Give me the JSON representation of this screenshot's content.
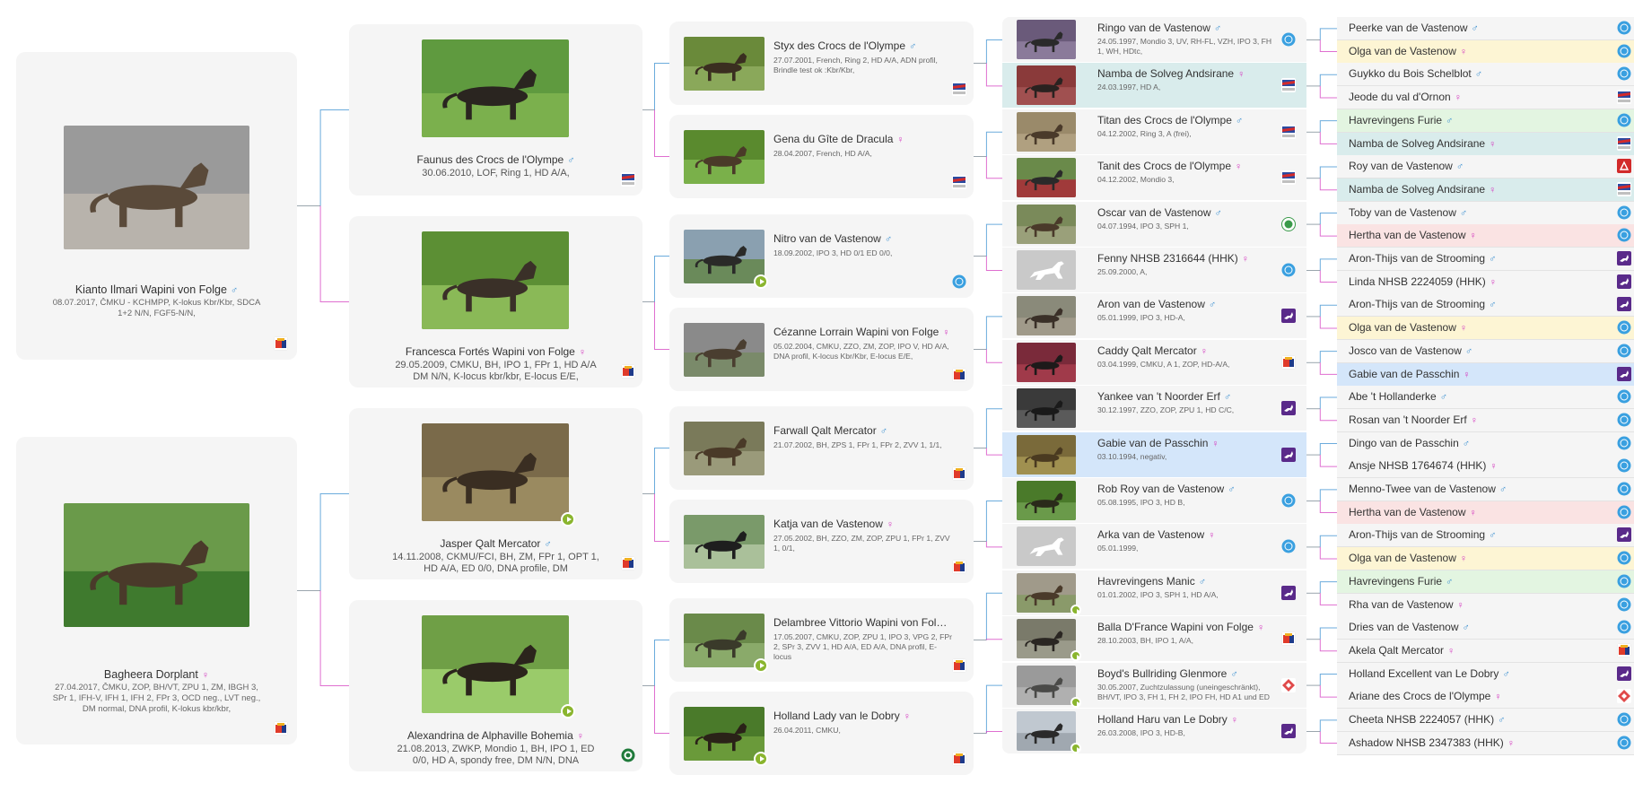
{
  "colors": {
    "male": "#3a8fd0",
    "female": "#d43fc0",
    "card_bg": "#f5f5f5",
    "line": "#9aa5ad",
    "highlight_teal": "#d9ecec",
    "highlight_blue": "#d4e6fa",
    "highlight_yellow": "#fdf5d4",
    "highlight_green": "#e3f5e1",
    "highlight_red": "#fae3e3"
  },
  "symbols": {
    "male": "♂",
    "female": "♀"
  },
  "gen1": [
    {
      "name": "Kianto Ilmari Wapini von Folge",
      "sex": "male",
      "info": "08.07.2017, ČMKU - KCHMPP, K-lokus Kbr/Kbr, SDCA 1+2 N/N, FGF5-N/N,",
      "flag": "cz-cmku",
      "photo": "dog-red-handler",
      "video": false
    },
    {
      "name": "Bagheera Dorplant",
      "sex": "female",
      "info": "27.04.2017, ČMKU, ZOP, BH/VT, ZPU 1, ZM, IBGH 3, SPr 1, IFH-V, IFH 1, IFH 2, FPr 3, OCD neg., LVT neg., DM normal, DNA profil, K-lokus kbr/kbr,",
      "flag": "cz-cmku",
      "photo": "dog-bite-training",
      "video": false
    }
  ],
  "gen2": [
    {
      "name": "Faunus des Crocs de l'Olympe",
      "sex": "male",
      "info": "30.06.2010, LOF, Ring 1, HD A/A,",
      "flag": "fr-lof",
      "photo": "dog-standing-grass",
      "video": false
    },
    {
      "name": "Francesca Fortés Wapini von Folge",
      "sex": "female",
      "info": "29.05.2009, CMKU, BH, IPO 1, FPr 1, HD A/A DM N/N, K-locus kbr/kbr, E-locus E/E,",
      "flag": "cz-cmku",
      "photo": "dog-stack-grass",
      "video": false
    },
    {
      "name": "Jasper Qalt Mercator",
      "sex": "male",
      "info": "14.11.2008, CKMU/FCI, BH, ZM, FPr 1, OPT 1, HD A/A, ED 0/0, DNA profile, DM",
      "flag": "cz-cmku",
      "photo": "dog-helper-dirt",
      "video": true
    },
    {
      "name": "Alexandrina de Alphaville Bohemia",
      "sex": "female",
      "info": "21.08.2013, ZWKP, Mondio 1, BH, IPO 1, ED 0/0, HD A, spondy free, DM N/N, DNA",
      "flag": "zwkp",
      "photo": "dog-head-portrait",
      "video": true
    }
  ],
  "gen3": [
    {
      "name": "Styx des Crocs de l'Olympe",
      "sex": "male",
      "info": "27.07.2001, French, Ring 2, HD A/A, ADN profil, Brindle test ok :Kbr/Kbr,",
      "flag": "fr-lof",
      "photo": "dog-sit-grass",
      "video": false
    },
    {
      "name": "Gena du Gîte de Dracula",
      "sex": "female",
      "info": "28.04.2007, French, HD A/A,",
      "flag": "fr-lof",
      "photo": "dog-grass-side",
      "video": false
    },
    {
      "name": "Nitro van de Vastenow",
      "sex": "male",
      "info": "18.09.2002, IPO 3, HD 0/1 ED 0/0,",
      "flag": "nl-ring",
      "photo": "dog-lake",
      "video": true
    },
    {
      "name": "Cézanne Lorrain Wapini von Folge",
      "sex": "female",
      "info": "05.02.2004, CMKU, ZZO, ZM, ZOP, IPO V, HD A/A, DNA profil, K-locus Kbr/Kbr, E-locus E/E,",
      "flag": "cz-cmku",
      "photo": "dog-pavement",
      "video": false
    },
    {
      "name": "Farwall Qalt Mercator",
      "sex": "male",
      "info": "21.07.2002, BH, ZPS 1, FPr 1, FPr 2, ZVV 1, 1/1,",
      "flag": "cz-cmku",
      "photo": "dog-head-brown",
      "video": false
    },
    {
      "name": "Katja van de Vastenow",
      "sex": "female",
      "info": "27.05.2002, BH, ZZO, ZM, ZOP, ZPU 1, FPr 1, ZVV 1, 0/1,",
      "flag": "cz-cmku",
      "photo": "dog-black-portrait",
      "video": false
    },
    {
      "name": "Delambree Vittorio Wapini von Folge ...",
      "sex": "male",
      "info": "17.05.2007, CMKU, ZOP, ZPU 1, IPO 3, VPG 2, FPr 2, SPr 3, ZVV 1, HD A/A, ED A/A, DNA profil, E-locus",
      "flag": "cz-cmku",
      "photo": "dog-grass-stand2",
      "video": true
    },
    {
      "name": "Holland Lady van le Dobry",
      "sex": "female",
      "info": "26.04.2011, CMKU,",
      "flag": "cz-cmku",
      "photo": "dog-grass-dark",
      "video": true
    }
  ],
  "gen4": [
    {
      "name": "Ringo van de Vastenow",
      "sex": "male",
      "info": "24.05.1997, Mondio 3, UV, RH-FL, VZH, IPO 3, FH 1, WH, HDtc,",
      "flag": "nl-ring",
      "photo": "dog-purple-bg",
      "video": false,
      "highlight": ""
    },
    {
      "name": "Namba de Solveg Andsirane",
      "sex": "female",
      "info": "24.03.1997, HD A,",
      "flag": "fr-lof",
      "photo": "dog-red-bg",
      "video": false,
      "highlight": "highlight_teal"
    },
    {
      "name": "Titan des Crocs de l'Olympe",
      "sex": "male",
      "info": "04.12.2002, Ring 3, A (frei),",
      "flag": "fr-lof",
      "photo": "dog-field",
      "video": false,
      "highlight": ""
    },
    {
      "name": "Tanit des Crocs de l'Olympe",
      "sex": "female",
      "info": "04.12.2002, Mondio 3,",
      "flag": "fr-lof",
      "photo": "dog-people-red",
      "video": false,
      "highlight": ""
    },
    {
      "name": "Oscar van de Vastenow",
      "sex": "male",
      "info": "04.07.1994, IPO 3, SPH 1,",
      "flag": "green-seal",
      "photo": "dog-trophy",
      "video": false,
      "highlight": ""
    },
    {
      "name": "Fenny NHSB 2316644 (HHK)",
      "sex": "female",
      "info": "25.09.2000, A,",
      "flag": "nl-ring",
      "photo": "placeholder",
      "video": false,
      "highlight": ""
    },
    {
      "name": "Aron van de Vastenow",
      "sex": "male",
      "info": "05.01.1999, IPO 3, HD-A,",
      "flag": "purple-dog",
      "photo": "dog-sit-dark",
      "video": false,
      "highlight": ""
    },
    {
      "name": "Caddy Qalt Mercator",
      "sex": "female",
      "info": "03.04.1999, CMKU, A 1, ZOP, HD-A/A,",
      "flag": "cz-cmku",
      "photo": "dog-red-banner",
      "video": false,
      "highlight": ""
    },
    {
      "name": "Yankee van 't Noorder Erf",
      "sex": "male",
      "info": "30.12.1997, ZZO, ZOP, ZPU 1, HD C/C,",
      "flag": "purple-dog",
      "photo": "dog-black-bg",
      "video": false,
      "highlight": ""
    },
    {
      "name": "Gabie van de Passchin",
      "sex": "female",
      "info": "03.10.1994, negativ,",
      "flag": "purple-dog",
      "photo": "dog-lying-brown",
      "video": false,
      "highlight": "highlight_blue"
    },
    {
      "name": "Rob Roy van de Vastenow",
      "sex": "male",
      "info": "05.08.1995, IPO 3, HD B,",
      "flag": "nl-ring",
      "photo": "dog-grass-green",
      "video": false,
      "highlight": ""
    },
    {
      "name": "Arka van de Vastenow",
      "sex": "female",
      "info": "05.01.1999,",
      "flag": "nl-ring",
      "photo": "placeholder",
      "video": false,
      "highlight": ""
    },
    {
      "name": "Havrevingens Manic",
      "sex": "male",
      "info": "01.01.2002, IPO 3, SPH 1, HD A/A,",
      "flag": "purple-dog",
      "photo": "dog-walk-field",
      "video": true,
      "highlight": ""
    },
    {
      "name": "Balla D'France Wapini von Folge",
      "sex": "female",
      "info": "28.10.2003, BH, IPO 1, A/A,",
      "flag": "cz-cmku",
      "photo": "dog-stand-dark",
      "video": true,
      "highlight": ""
    },
    {
      "name": "Boyd's Bullriding Glenmore",
      "sex": "male",
      "info": "30.05.2007, Zuchtzulassung (uneingeschränkt), BH/VT, IPO 3, FH 1, FH 2, IPO FH, HD A1 und ED 0, Schaltwirbel,",
      "flag": "red-diamond",
      "photo": "dog-grey",
      "video": true,
      "highlight": ""
    },
    {
      "name": "Holland Haru van Le Dobry",
      "sex": "female",
      "info": "26.03.2008, IPO 3, HD-B,",
      "flag": "purple-dog",
      "photo": "dog-snow",
      "video": true,
      "highlight": ""
    }
  ],
  "gen5": [
    {
      "name": "Peerke van de Vastenow",
      "sex": "male",
      "flag": "nl-ring",
      "highlight": ""
    },
    {
      "name": "Olga van de Vastenow",
      "sex": "female",
      "flag": "nl-ring",
      "highlight": "highlight_yellow"
    },
    {
      "name": "Guykko du Bois Schelblot",
      "sex": "male",
      "flag": "nl-ring",
      "highlight": ""
    },
    {
      "name": "Jeode du val d'Ornon",
      "sex": "female",
      "flag": "fr-lof",
      "highlight": ""
    },
    {
      "name": "Havrevingens Furie",
      "sex": "male",
      "flag": "nl-ring",
      "highlight": "highlight_green"
    },
    {
      "name": "Namba de Solveg Andsirane",
      "sex": "female",
      "flag": "fr-lof",
      "highlight": "highlight_teal"
    },
    {
      "name": "Roy van de Vastenow",
      "sex": "male",
      "flag": "red-square",
      "highlight": ""
    },
    {
      "name": "Namba de Solveg Andsirane",
      "sex": "female",
      "flag": "fr-lof",
      "highlight": "highlight_teal"
    },
    {
      "name": "Toby van de Vastenow",
      "sex": "male",
      "flag": "nl-ring",
      "highlight": ""
    },
    {
      "name": "Hertha van de Vastenow",
      "sex": "female",
      "flag": "nl-ring",
      "highlight": "highlight_red"
    },
    {
      "name": "Aron-Thijs van de Strooming",
      "sex": "male",
      "flag": "purple-dog",
      "highlight": ""
    },
    {
      "name": "Linda NHSB 2224059 (HHK)",
      "sex": "female",
      "flag": "purple-dog",
      "highlight": ""
    },
    {
      "name": "Aron-Thijs van de Strooming",
      "sex": "male",
      "flag": "purple-dog",
      "highlight": ""
    },
    {
      "name": "Olga van de Vastenow",
      "sex": "female",
      "flag": "nl-ring",
      "highlight": "highlight_yellow"
    },
    {
      "name": "Josco van de Vastenow",
      "sex": "male",
      "flag": "nl-ring",
      "highlight": ""
    },
    {
      "name": "Gabie van de Passchin",
      "sex": "female",
      "flag": "purple-dog",
      "highlight": "highlight_blue"
    },
    {
      "name": "Abe 't Hollanderke",
      "sex": "male",
      "flag": "nl-ring",
      "highlight": ""
    },
    {
      "name": "Rosan van 't Noorder Erf",
      "sex": "female",
      "flag": "nl-ring",
      "highlight": ""
    },
    {
      "name": "Dingo van de Passchin",
      "sex": "male",
      "flag": "nl-ring",
      "highlight": ""
    },
    {
      "name": "Ansje NHSB 1764674 (HHK)",
      "sex": "female",
      "flag": "nl-ring",
      "highlight": ""
    },
    {
      "name": "Menno-Twee van de Vastenow",
      "sex": "male",
      "flag": "nl-ring",
      "highlight": ""
    },
    {
      "name": "Hertha van de Vastenow",
      "sex": "female",
      "flag": "nl-ring",
      "highlight": "highlight_red"
    },
    {
      "name": "Aron-Thijs van de Strooming",
      "sex": "male",
      "flag": "purple-dog",
      "highlight": ""
    },
    {
      "name": "Olga van de Vastenow",
      "sex": "female",
      "flag": "nl-ring",
      "highlight": "highlight_yellow"
    },
    {
      "name": "Havrevingens Furie",
      "sex": "male",
      "flag": "nl-ring",
      "highlight": "highlight_green"
    },
    {
      "name": "Rha van de Vastenow",
      "sex": "female",
      "flag": "nl-ring",
      "highlight": ""
    },
    {
      "name": "Dries van de Vastenow",
      "sex": "male",
      "flag": "nl-ring",
      "highlight": ""
    },
    {
      "name": "Akela Qalt Mercator",
      "sex": "female",
      "flag": "cz-cmku",
      "highlight": ""
    },
    {
      "name": "Holland Excellent van Le Dobry",
      "sex": "male",
      "flag": "purple-dog",
      "highlight": ""
    },
    {
      "name": "Ariane des Crocs de l'Olympe",
      "sex": "female",
      "flag": "red-diamond",
      "highlight": ""
    },
    {
      "name": "Cheeta NHSB 2224057 (HHK)",
      "sex": "male",
      "flag": "nl-ring",
      "highlight": ""
    },
    {
      "name": "Ashadow NHSB 2347383 (HHK)",
      "sex": "female",
      "flag": "nl-ring",
      "highlight": ""
    }
  ]
}
